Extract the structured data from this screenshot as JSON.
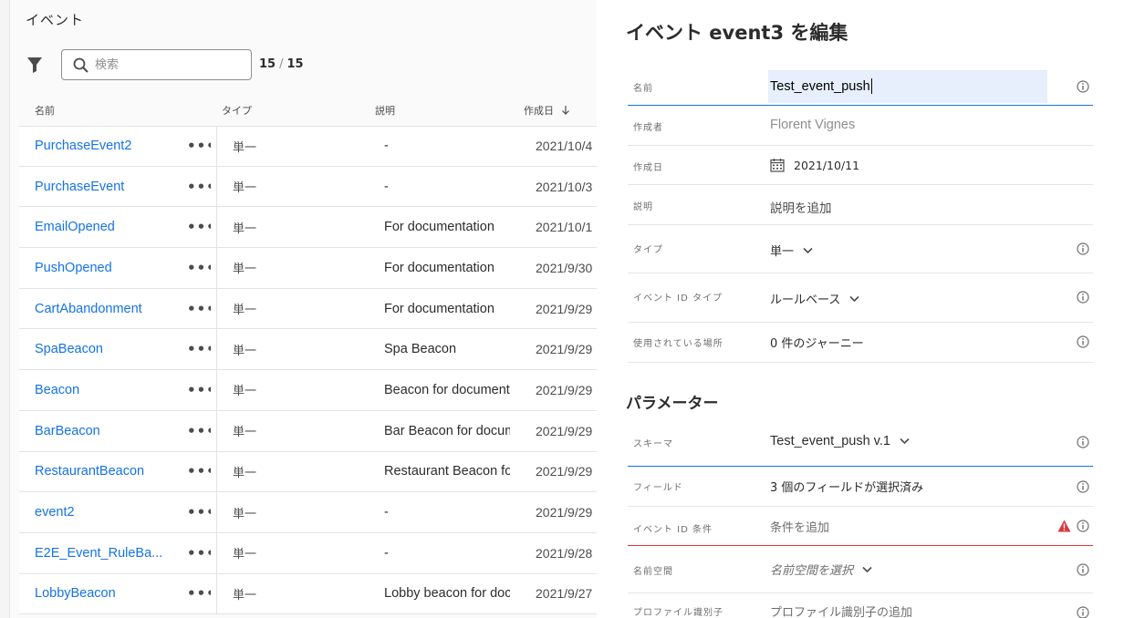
{
  "list": {
    "title": "イベント",
    "search_placeholder": "検索",
    "count_shown": "15",
    "count_sep": "/",
    "count_total": "15",
    "columns": {
      "name": "名前",
      "type": "タイプ",
      "description": "説明",
      "created": "作成日"
    },
    "more_label": "•••",
    "rows": [
      {
        "name": "PurchaseEvent2",
        "type": "単一",
        "description": "-",
        "created": "2021/10/4"
      },
      {
        "name": "PurchaseEvent",
        "type": "単一",
        "description": "-",
        "created": "2021/10/3"
      },
      {
        "name": "EmailOpened",
        "type": "単一",
        "description": "For documentation",
        "created": "2021/10/1"
      },
      {
        "name": "PushOpened",
        "type": "単一",
        "description": "For documentation",
        "created": "2021/9/30"
      },
      {
        "name": "CartAbandonment",
        "type": "単一",
        "description": "For documentation",
        "created": "2021/9/29"
      },
      {
        "name": "SpaBeacon",
        "type": "単一",
        "description": "Spa Beacon",
        "created": "2021/9/29"
      },
      {
        "name": "Beacon",
        "type": "単一",
        "description": "Beacon for documenta",
        "created": "2021/9/29"
      },
      {
        "name": "BarBeacon",
        "type": "単一",
        "description": "Bar Beacon for docum",
        "created": "2021/9/29"
      },
      {
        "name": "RestaurantBeacon",
        "type": "単一",
        "description": "Restaurant Beacon for",
        "created": "2021/9/29"
      },
      {
        "name": "event2",
        "type": "単一",
        "description": "-",
        "created": "2021/9/29"
      },
      {
        "name": "E2E_Event_RuleBa...",
        "type": "単一",
        "description": "-",
        "created": "2021/9/28"
      },
      {
        "name": "LobbyBeacon",
        "type": "単一",
        "description": "Lobby beacon for doc",
        "created": "2021/9/27"
      }
    ]
  },
  "editor": {
    "title": "イベント event3 を編集",
    "name": {
      "label": "名前",
      "value": "Test_event_push"
    },
    "author": {
      "label": "作成者",
      "value": "Florent Vignes"
    },
    "created": {
      "label": "作成日",
      "value": "2021/10/11"
    },
    "description": {
      "label": "説明",
      "placeholder": "説明を追加"
    },
    "type": {
      "label": "タイプ",
      "value": "単一"
    },
    "event_id_type": {
      "label": "イベント ID タイプ",
      "value": "ルールベース"
    },
    "used_in": {
      "label": "使用されている場所",
      "value": "0 件のジャーニー"
    },
    "parameters_title": "パラメーター",
    "schema": {
      "label": "スキーマ",
      "value": "Test_event_push v.1"
    },
    "fields": {
      "label": "フィールド",
      "value": "3 個のフィールドが選択済み"
    },
    "event_id_condition": {
      "label": "イベント ID 条件",
      "placeholder": "条件を追加"
    },
    "namespace": {
      "label": "名前空間",
      "placeholder": "名前空間を選択"
    },
    "profile_id": {
      "label": "プロファイル識別子",
      "placeholder": "プロファイル識別子の追加"
    }
  },
  "colors": {
    "link": "#1473e6",
    "focus_underline": "#1473e6",
    "error_underline": "#d7373f",
    "warning": "#d7373f",
    "input_highlight": "#e6effb"
  },
  "icons": [
    "filter-icon",
    "search-icon",
    "sort-descending-icon",
    "more-icon",
    "info-icon",
    "calendar-icon",
    "chevron-down-icon",
    "alert-icon"
  ]
}
